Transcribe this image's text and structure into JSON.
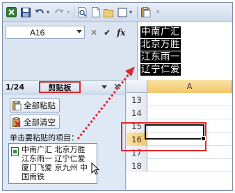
{
  "window": {
    "quick_access_icons": [
      "excel-logo-icon",
      "save-icon",
      "undo-icon",
      "undo-dropdown-icon",
      "redo-icon",
      "redo-dropdown-icon",
      "print-preview-icon",
      "new-document-icon",
      "open-icon",
      "shape-icon",
      "shape-dropdown-icon",
      "paste-icon",
      "more-commands-icon"
    ]
  },
  "formula_bar": {
    "name_box": "A16",
    "cancel_symbol": "✕",
    "enter_symbol": "✔",
    "fx_symbol": "fx",
    "content_lines": [
      "中南广汇",
      "北京万胜",
      "江东雨一",
      "辽宁仁爱"
    ]
  },
  "clipboard_pane": {
    "count": "1/24",
    "title": "剪贴板",
    "paste_all_label": "全部粘贴",
    "clear_all_label": "全部清空",
    "instruction": "单击要粘贴的项目：",
    "items": [
      {
        "text": "中南广汇 北京万胜 江东雨一 辽宁仁爱 厦门飞爱 京九州 中国南铁"
      }
    ]
  },
  "sheet": {
    "column_header": "A",
    "rows": [
      "13",
      "14",
      "15",
      "16",
      "17",
      "18"
    ],
    "active_row": "16"
  },
  "annotation_colors": {
    "highlight": "#e0252b",
    "arrow": "#e0252b"
  }
}
